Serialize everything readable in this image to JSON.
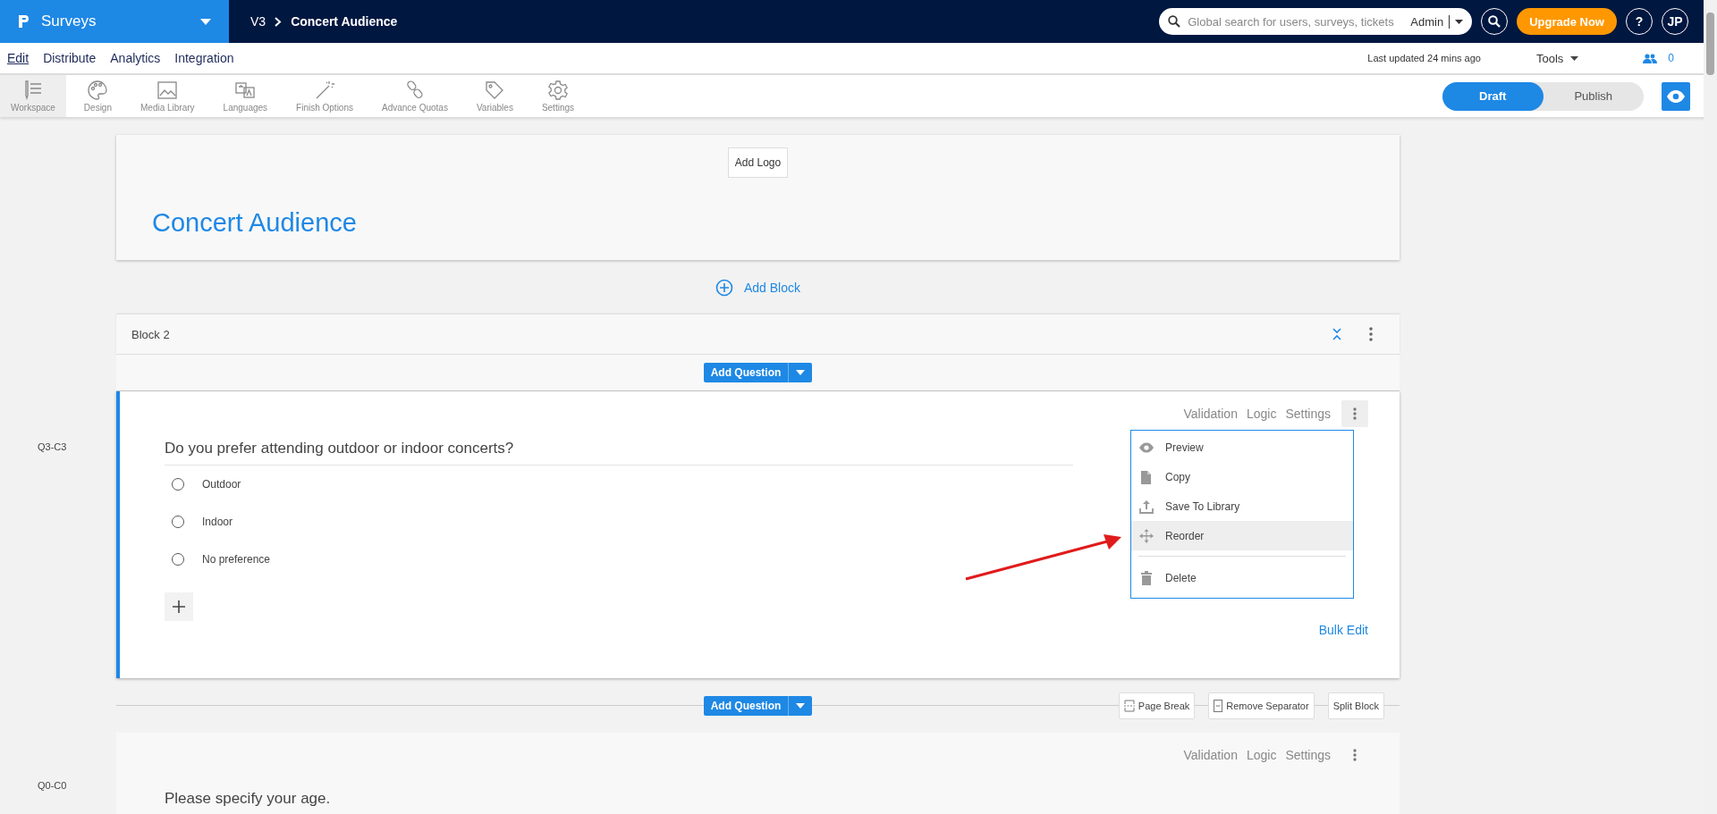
{
  "app_switcher": {
    "label": "Surveys"
  },
  "breadcrumb": [
    "V3",
    "Concert Audience"
  ],
  "search": {
    "placeholder": "Global search for users, surveys, tickets",
    "scope": "Admin"
  },
  "upgrade_button": "Upgrade Now",
  "help_button": "?",
  "avatar": "JP",
  "menu": [
    {
      "label": "Edit",
      "selected": true
    },
    {
      "label": "Distribute",
      "selected": false
    },
    {
      "label": "Analytics",
      "selected": false
    },
    {
      "label": "Integration",
      "selected": false
    }
  ],
  "last_updated": "Last updated 24 mins ago",
  "tools": "Tools",
  "collaborators": "0",
  "toolbar": [
    {
      "label": "Workspace",
      "selected": true
    },
    {
      "label": "Design",
      "selected": false
    },
    {
      "label": "Media Library",
      "selected": false
    },
    {
      "label": "Languages",
      "selected": false
    },
    {
      "label": "Finish Options",
      "selected": false
    },
    {
      "label": "Advance Quotas",
      "selected": false
    },
    {
      "label": "Variables",
      "selected": false
    },
    {
      "label": "Settings",
      "selected": false
    }
  ],
  "mode_toggle": [
    {
      "label": "Draft",
      "selected": true
    },
    {
      "label": "Publish",
      "selected": false
    }
  ],
  "survey": {
    "add_logo": "Add Logo",
    "title": "Concert Audience"
  },
  "add_block": "Add Block",
  "block": {
    "title": "Block 2",
    "add_question": "Add Question",
    "question": {
      "code": "Q3-C3",
      "actions": [
        "Validation",
        "Logic",
        "Settings"
      ],
      "text": "Do you prefer attending outdoor or indoor concerts?",
      "options": [
        {
          "label": "Outdoor",
          "selected": false
        },
        {
          "label": "Indoor",
          "selected": false
        },
        {
          "label": "No preference",
          "selected": false
        }
      ],
      "bulk_edit": "Bulk Edit",
      "context_menu": [
        {
          "label": "Preview",
          "kind": "preview",
          "selected": false,
          "divider_before": false
        },
        {
          "label": "Copy",
          "kind": "copy",
          "selected": false,
          "divider_before": false
        },
        {
          "label": "Save To Library",
          "kind": "upload",
          "selected": false,
          "divider_before": false
        },
        {
          "label": "Reorder",
          "kind": "move",
          "selected": true,
          "divider_before": false
        },
        {
          "label": "Delete",
          "kind": "delete",
          "selected": false,
          "divider_before": true
        }
      ]
    }
  },
  "separator": {
    "add_question": "Add Question",
    "buttons": [
      {
        "label": "Page Break",
        "kind": "pagebreak"
      },
      {
        "label": "Remove Separator",
        "kind": "remove"
      },
      {
        "label": "Split Block",
        "kind": "plain"
      }
    ]
  },
  "next_question": {
    "code": "Q0-C0",
    "actions": [
      "Validation",
      "Logic",
      "Settings"
    ],
    "text": "Please specify your age."
  }
}
